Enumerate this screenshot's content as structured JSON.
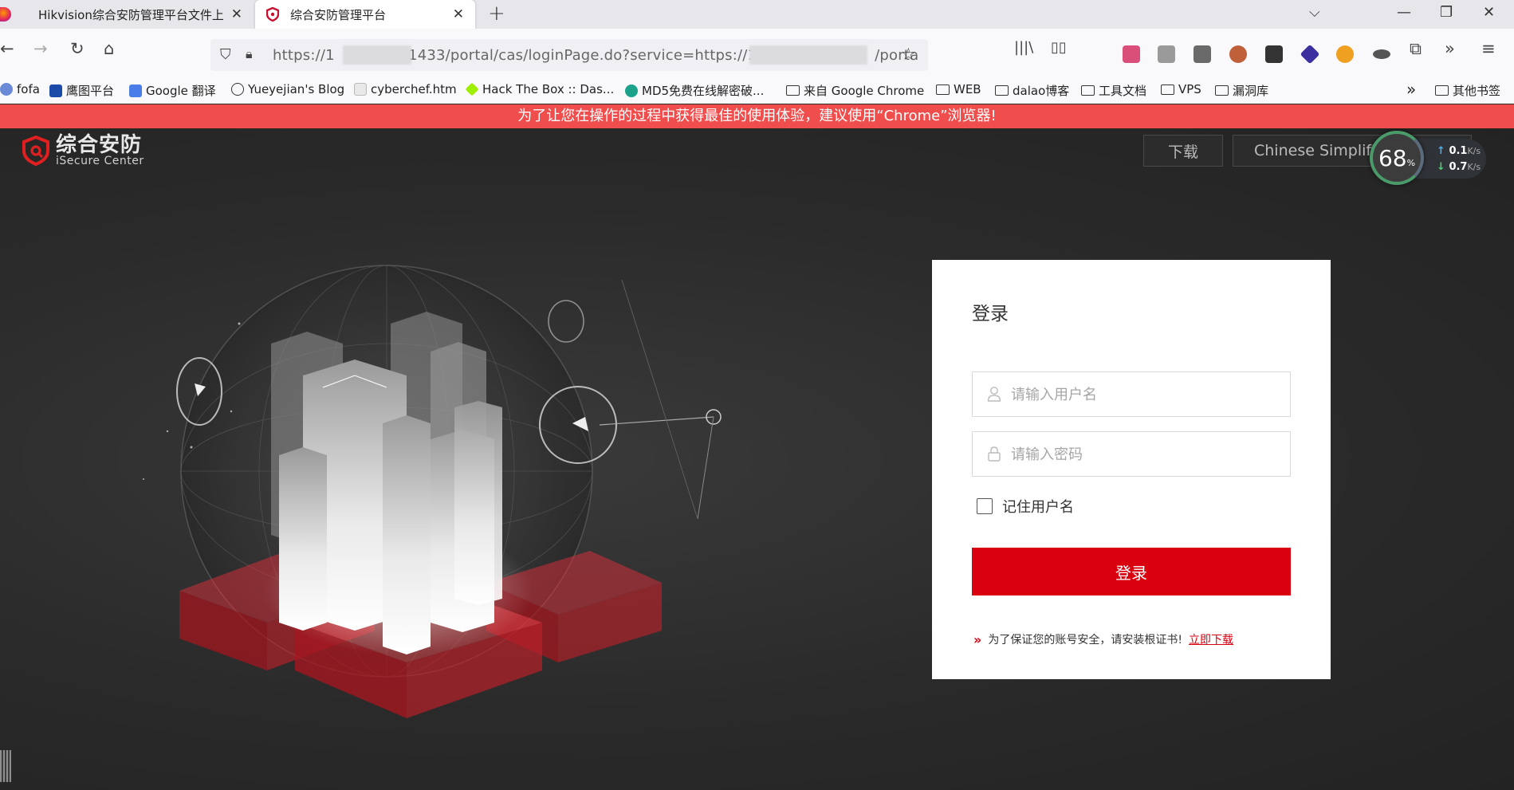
{
  "browser": {
    "tabs": [
      {
        "label": "Hikvision综合安防管理平台文件上传",
        "active": false
      },
      {
        "label": "综合安防管理平台",
        "active": true
      }
    ],
    "url": {
      "part1": "https://1",
      "part2": ":1433/portal/cas/loginPage.do?service=https://1",
      "part3": "/porta"
    },
    "bookmarks": [
      {
        "label": "fofa",
        "icon": "fofa-icon"
      },
      {
        "label": "鹰图平台",
        "icon": "hunter-icon"
      },
      {
        "label": "Google 翻译",
        "icon": "google-translate-icon"
      },
      {
        "label": "Yueyejian's Blog",
        "icon": "globe-icon"
      },
      {
        "label": "cyberchef.htm",
        "icon": "chef-hat-icon"
      },
      {
        "label": "Hack The Box :: Das...",
        "icon": "htb-cube-icon"
      },
      {
        "label": "MD5免费在线解密破...",
        "icon": "md5-icon"
      },
      {
        "label": "来自 Google Chrome",
        "icon": "folder-icon"
      },
      {
        "label": "WEB",
        "icon": "folder-icon"
      },
      {
        "label": "dalao博客",
        "icon": "folder-icon"
      },
      {
        "label": "工具文档",
        "icon": "folder-icon"
      },
      {
        "label": "VPS",
        "icon": "folder-icon"
      },
      {
        "label": "漏洞库",
        "icon": "folder-icon"
      }
    ],
    "other_bookmarks": "其他书签"
  },
  "page": {
    "banner": "为了让您在操作的过程中获得最佳的使用体验，建议使用“Chrome”浏览器!",
    "logo": {
      "cn": "综合安防",
      "en": "iSecure Center"
    },
    "download_button": "下载",
    "language_button": "Chinese Simplified",
    "speed": {
      "percent": "68",
      "percent_unit": "%",
      "up": "0.1",
      "down": "0.7",
      "unit": "K/s"
    },
    "login": {
      "title": "登录",
      "username_placeholder": "请输入用户名",
      "password_placeholder": "请输入密码",
      "remember_label": "记住用户名",
      "submit_label": "登录",
      "cert_note": "为了保证您的账号安全，请安装根证书!",
      "cert_link": "立即下载"
    }
  },
  "colors": {
    "brand_red": "#d9000f",
    "banner_red": "#f04d4d",
    "page_bg": "#2b2b2b"
  }
}
